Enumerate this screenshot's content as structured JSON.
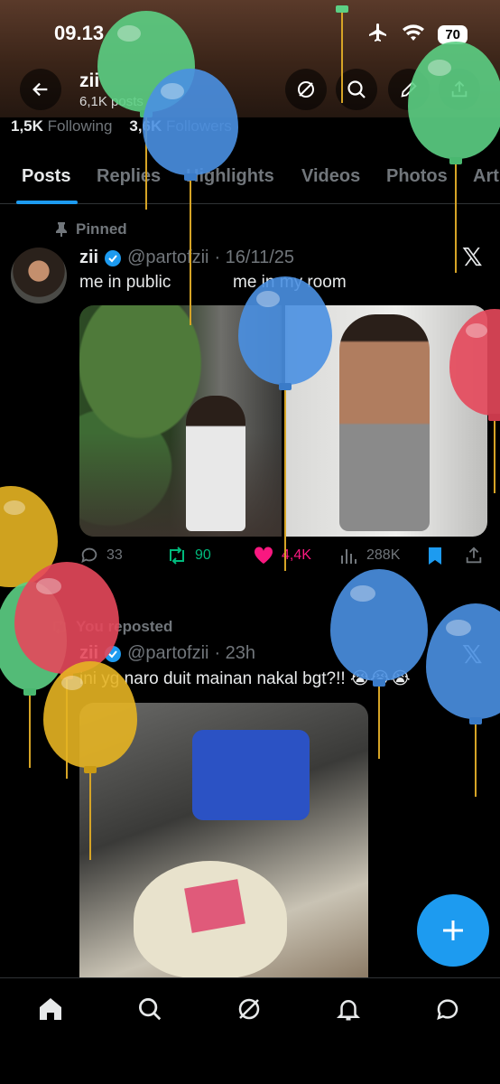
{
  "status_bar": {
    "time": "09.13",
    "battery": "70"
  },
  "header": {
    "name": "zii",
    "posts": "6,1K posts"
  },
  "follow": {
    "following_count": "1,5K",
    "following_label": "Following",
    "followers_count": "3,6K",
    "followers_label": "Followers"
  },
  "tabs": [
    "Posts",
    "Replies",
    "Highlights",
    "Videos",
    "Photos",
    "Art"
  ],
  "post1": {
    "label": "Pinned",
    "name": "zii",
    "handle": "@partofzii",
    "date": "· 16/11/25",
    "text": "me in public             me in my room",
    "replies": "33",
    "reposts": "90",
    "likes": "4,4K",
    "views": "288K"
  },
  "post2": {
    "label": "You reposted",
    "name": "zii",
    "handle": "@partofzii",
    "date": "· 23h",
    "text": "ini yg naro duit mainan nakal bgt?!! 😭😭😭"
  },
  "x_logo": "𝕏",
  "colors": {
    "accent": "#1d9bf0",
    "repost": "#00ba7c",
    "like": "#f91880",
    "balloon_green": "#5ccf84",
    "balloon_blue": "#4a90e2",
    "balloon_red": "#e5485b",
    "balloon_yellow": "#e6b422"
  },
  "icons": [
    "back-arrow-icon",
    "grok-icon",
    "search-icon",
    "edit-icon",
    "share-icon",
    "pin-icon",
    "verified-icon",
    "reply-icon",
    "repost-icon",
    "heart-icon",
    "views-icon",
    "bookmark-icon",
    "home-icon",
    "notifications-icon",
    "messages-icon",
    "plus-icon"
  ]
}
